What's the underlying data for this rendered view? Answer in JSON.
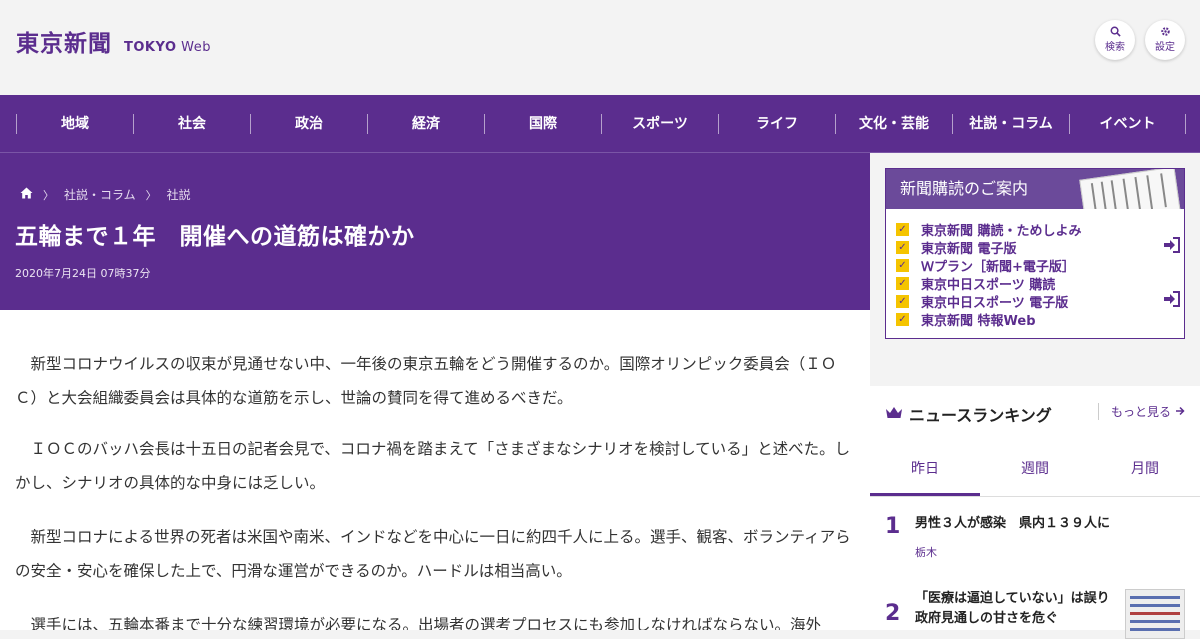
{
  "header": {
    "logo_jp": "東京新聞",
    "logo_en_bold": "TOKYO",
    "logo_en_light": " Web",
    "search_label": "検索",
    "settings_label": "設定"
  },
  "nav": {
    "items": [
      "地域",
      "社会",
      "政治",
      "経済",
      "国際",
      "スポーツ",
      "ライフ",
      "文化・芸能",
      "社説・コラム",
      "イベント"
    ]
  },
  "breadcrumb": {
    "items": [
      "社説・コラム",
      "社説"
    ]
  },
  "article": {
    "title": "五輪まで１年　開催への道筋は確かか",
    "date": "2020年7月24日 07時37分",
    "paragraphs": [
      "新型コロナウイルスの収束が見通せない中、一年後の東京五輪をどう開催するのか。国際オリンピック委員会（ＩＯＣ）と大会組織委員会は具体的な道筋を示し、世論の賛同を得て進めるべきだ。",
      "ＩＯＣのバッハ会長は十五日の記者会見で、コロナ禍を踏まえて「さまざまなシナリオを検討している」と述べた。しかし、シナリオの具体的な中身には乏しい。",
      "新型コロナによる世界の死者は米国や南米、インドなどを中心に一日に約四千人に上る。選手、観客、ボランティアらの安全・安心を確保した上で、円滑な運営ができるのか。ハードルは相当高い。",
      "選手には、五輪本番まで十分な練習環境が必要になる。出場者の選考プロセスにも参加しなければならない。海外"
    ]
  },
  "subscription": {
    "heading": "新聞購読のご案内",
    "links": [
      "東京新聞 購読・ためしよみ",
      "東京新聞 電子版",
      "Ｗプラン［新聞+電子版］",
      "東京中日スポーツ 購読",
      "東京中日スポーツ 電子版",
      "東京新聞 特報Web"
    ]
  },
  "ranking": {
    "title": "ニュースランキング",
    "more": "もっと見る",
    "tabs": [
      "昨日",
      "週間",
      "月間"
    ],
    "items": [
      {
        "rank": "1",
        "headline": "男性３人が感染　県内１３９人に",
        "tag": "栃木"
      },
      {
        "rank": "2",
        "headline": "「医療は逼迫していない」は誤り　政府見通しの甘さを危ぐ",
        "tag": ""
      }
    ]
  },
  "colors": {
    "brand": "#5b2d8e",
    "accent_check": "#f5c400"
  }
}
